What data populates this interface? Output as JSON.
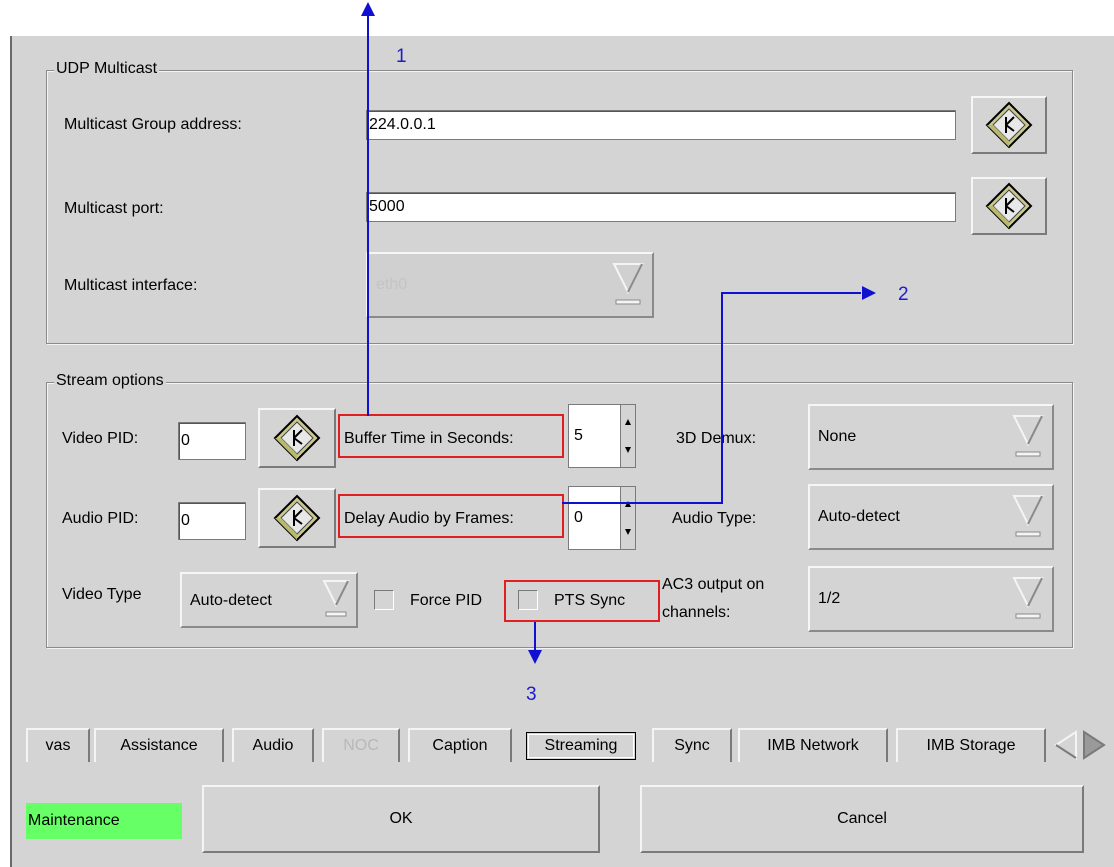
{
  "udp_group": {
    "title": "UDP Multicast",
    "group_address_label": "Multicast Group address:",
    "group_address_value": "224.0.0.1",
    "port_label": "Multicast port:",
    "port_value": "5000",
    "interface_label": "Multicast interface:",
    "interface_value": "eth0"
  },
  "stream_group": {
    "title": "Stream options",
    "video_pid_label": "Video PID:",
    "video_pid_value": "0",
    "audio_pid_label": "Audio PID:",
    "audio_pid_value": "0",
    "buffer_time_label": "Buffer Time in Seconds:",
    "buffer_time_value": "5",
    "delay_audio_label": "Delay Audio by Frames:",
    "delay_audio_value": "0",
    "demux_label": "3D Demux:",
    "demux_value": "None",
    "audio_type_label": "Audio Type:",
    "audio_type_value": "Auto-detect",
    "video_type_label": "Video Type",
    "video_type_value": "Auto-detect",
    "force_pid_label": "Force PID",
    "force_pid_checked": false,
    "pts_sync_label": "PTS Sync",
    "pts_sync_checked": false,
    "ac3_label_line1": "AC3 output on",
    "ac3_label_line2": "channels:",
    "ac3_value": "1/2"
  },
  "tabs": [
    {
      "label": "vas",
      "active": false,
      "disabled": false
    },
    {
      "label": "Assistance",
      "active": false,
      "disabled": false
    },
    {
      "label": "Audio",
      "active": false,
      "disabled": false
    },
    {
      "label": "NOC",
      "active": false,
      "disabled": true
    },
    {
      "label": "Caption",
      "active": false,
      "disabled": false
    },
    {
      "label": "Streaming",
      "active": true,
      "disabled": false
    },
    {
      "label": "Sync",
      "active": false,
      "disabled": false
    },
    {
      "label": "IMB Network",
      "active": false,
      "disabled": false
    },
    {
      "label": "IMB Storage",
      "active": false,
      "disabled": false
    }
  ],
  "footer": {
    "mode_badge": "Maintenance",
    "ok_label": "OK",
    "cancel_label": "Cancel"
  },
  "annotations": {
    "callout_1": "1",
    "callout_2": "2",
    "callout_3": "3"
  },
  "colors": {
    "panel_bg": "#d4d4d4",
    "highlight_red": "#e02020",
    "annotation_blue": "#1010d0",
    "maintenance_green": "#66ff66"
  }
}
